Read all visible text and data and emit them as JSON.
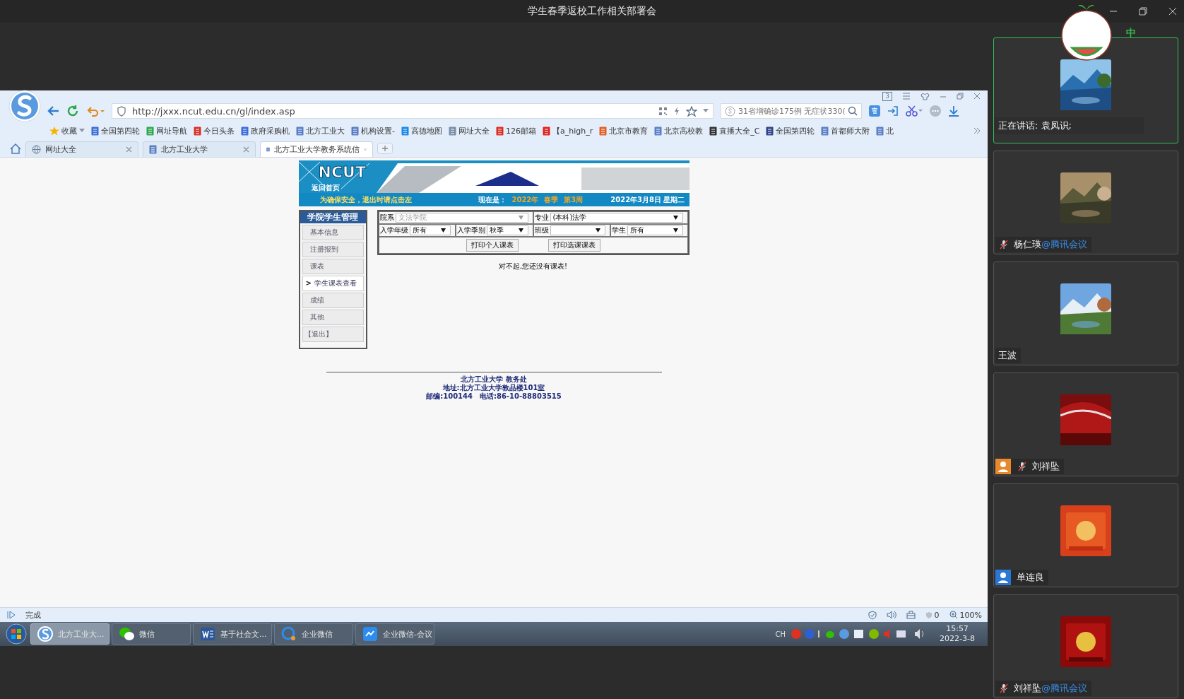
{
  "meeting": {
    "title": "学生春季返校工作相关部署会"
  },
  "browser": {
    "url": "http://jxxx.ncut.edu.cn/gl/index.asp",
    "window_count": "3",
    "search": {
      "placeholder": "31省增确诊175例 无症状330("
    },
    "bookmarks": [
      {
        "label": "收藏"
      },
      {
        "label": "全国第四轮"
      },
      {
        "label": "网址导航"
      },
      {
        "label": "今日头条"
      },
      {
        "label": "政府采购机"
      },
      {
        "label": "北方工业大"
      },
      {
        "label": "机构设置-"
      },
      {
        "label": "高德地图"
      },
      {
        "label": "网址大全"
      },
      {
        "label": "126邮箱"
      },
      {
        "label": "【a_high_r"
      },
      {
        "label": "北京市教育"
      },
      {
        "label": "北京高校教"
      },
      {
        "label": "直播大全_C"
      },
      {
        "label": "全国第四轮"
      },
      {
        "label": "首都师大附"
      },
      {
        "label": "北"
      }
    ],
    "tabs": [
      {
        "label": "网址大全",
        "selected": false
      },
      {
        "label": "北方工业大学",
        "selected": false
      },
      {
        "label": "北方工业大学教务系统信",
        "selected": true
      }
    ]
  },
  "page": {
    "banner": {
      "logo": "NCUT",
      "home_link": "返回首页",
      "notice": "为确保安全，退出时请点击左",
      "now_label": "现在是：",
      "year": "2022年",
      "season": "春季",
      "week": "第3周",
      "date": "2022年3月8日  星期二"
    },
    "sidebar": {
      "title": "学院学生管理",
      "items": [
        {
          "label": "基本信息",
          "selected": false
        },
        {
          "label": "注册报到",
          "selected": false
        },
        {
          "label": "课表",
          "selected": false
        },
        {
          "label": "学生课表查看",
          "marker": ">",
          "selected": true
        },
        {
          "label": "成绩",
          "selected": false
        },
        {
          "label": "其他",
          "selected": false
        },
        {
          "label": "【退出】",
          "selected": false
        }
      ]
    },
    "form": {
      "rows": [
        [
          {
            "label": "院系",
            "value": "文法学院",
            "disabled": true
          },
          "",
          {
            "label": "专业",
            "value": "(本科)法学",
            "disabled": false
          },
          ""
        ],
        [
          {
            "label": "入学年级",
            "value": "所有",
            "disabled": false
          },
          {
            "label": "入学季别",
            "value": "秋季",
            "disabled": false
          },
          {
            "label": "班级",
            "disabled": false
          },
          {
            "label": "学生",
            "value": "所有",
            "disabled": false
          }
        ]
      ],
      "buttons": [
        "打印个人课表",
        "打印选课课表"
      ]
    },
    "message": "对不起,您还没有课表!",
    "footer": [
      "北方工业大学 教务处",
      "地址:北方工业大学敦品楼101室",
      "邮编:100144　电话:86-10-88803515"
    ]
  },
  "status_bar": {
    "text": "完成",
    "count": "0",
    "zoom": "100%"
  },
  "taskbar": {
    "items": [
      {
        "label": "北方工业大...",
        "selected": true
      },
      {
        "label": "微信",
        "selected": false
      },
      {
        "label": "基于社会文...",
        "selected": false
      },
      {
        "label": "企业微信",
        "selected": false
      },
      {
        "label": "企业微信-会议",
        "selected": false
      }
    ],
    "input_language": "CH",
    "time": "15:57",
    "date": "2022-3-8"
  },
  "meeting_panel": {
    "ime_indicator": "中",
    "speaking": "正在讲话: 袁凤识;",
    "participants": [
      {
        "name": "杨仁瑛",
        "suffix": "@腾讯会议",
        "muted": true
      },
      {
        "name": "王波",
        "muted": false
      },
      {
        "name": "刘祥坠",
        "muted": true,
        "color": "#e8892c"
      },
      {
        "name": "单连良",
        "muted": false,
        "color": "#2a78d6"
      },
      {
        "name": "刘祥坠",
        "suffix": "@腾讯会议",
        "muted": true
      }
    ]
  }
}
